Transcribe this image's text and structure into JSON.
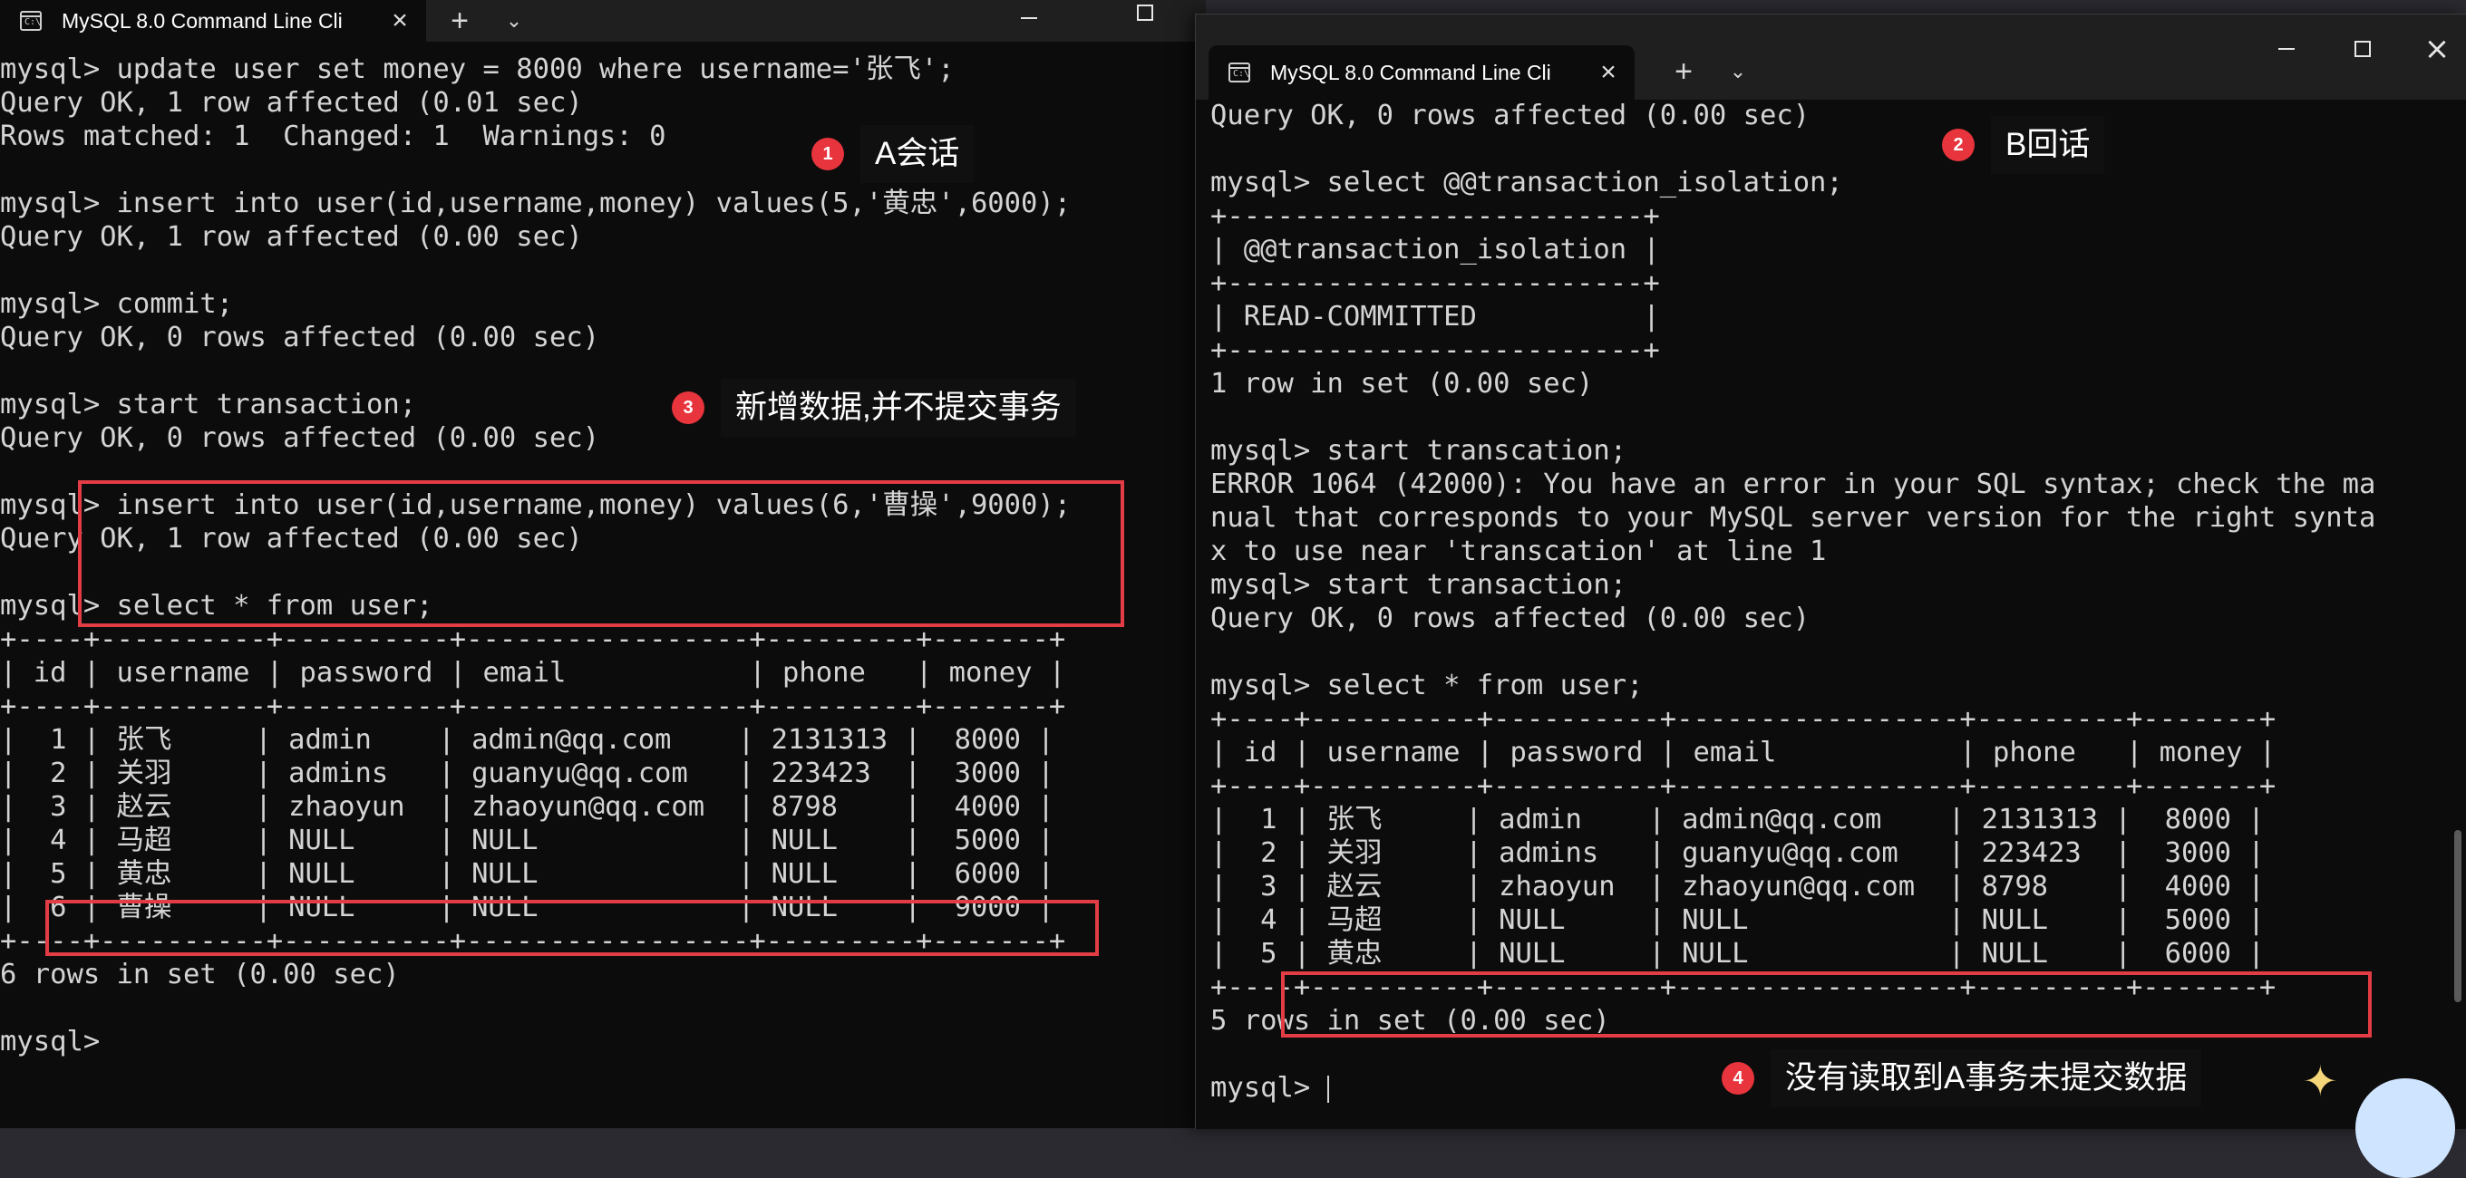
{
  "windowA": {
    "tab_title": "MySQL 8.0 Command Line Cli",
    "tab_icon_text": "C:\\",
    "terminal_text": "mysql> update user set money = 8000 where username='张飞';\nQuery OK, 1 row affected (0.01 sec)\nRows matched: 1  Changed: 1  Warnings: 0\n\nmysql> insert into user(id,username,money) values(5,'黄忠',6000);\nQuery OK, 1 row affected (0.00 sec)\n\nmysql> commit;\nQuery OK, 0 rows affected (0.00 sec)\n\nmysql> start transaction;\nQuery OK, 0 rows affected (0.00 sec)\n\nmysql> insert into user(id,username,money) values(6,'曹操',9000);\nQuery OK, 1 row affected (0.00 sec)\n\nmysql> select * from user;\n+----+----------+----------+-----------------+---------+-------+\n| id | username | password | email           | phone   | money |\n+----+----------+----------+-----------------+---------+-------+\n|  1 | 张飞     | admin    | admin@qq.com    | 2131313 |  8000 |\n|  2 | 关羽     | admins   | guanyu@qq.com   | 223423  |  3000 |\n|  3 | 赵云     | zhaoyun  | zhaoyun@qq.com  | 8798    |  4000 |\n|  4 | 马超     | NULL     | NULL            | NULL    |  5000 |\n|  5 | 黄忠     | NULL     | NULL            | NULL    |  6000 |\n|  6 | 曹操     | NULL     | NULL            | NULL    |  9000 |\n+----+----------+----------+-----------------+---------+-------+\n6 rows in set (0.00 sec)\n\nmysql>"
  },
  "windowB": {
    "tab_title": "MySQL 8.0 Command Line Cli",
    "tab_icon_text": "C:\\",
    "terminal_text": "Query OK, 0 rows affected (0.00 sec)\n\nmysql> select @@transaction_isolation;\n+-------------------------+\n| @@transaction_isolation |\n+-------------------------+\n| READ-COMMITTED          |\n+-------------------------+\n1 row in set (0.00 sec)\n\nmysql> start transcation;\nERROR 1064 (42000): You have an error in your SQL syntax; check the ma\nnual that corresponds to your MySQL server version for the right synta\nx to use near 'transcation' at line 1\nmysql> start transaction;\nQuery OK, 0 rows affected (0.00 sec)\n\nmysql> select * from user;\n+----+----------+----------+-----------------+---------+-------+\n| id | username | password | email           | phone   | money |\n+----+----------+----------+-----------------+---------+-------+\n|  1 | 张飞     | admin    | admin@qq.com    | 2131313 |  8000 |\n|  2 | 关羽     | admins   | guanyu@qq.com   | 223423  |  3000 |\n|  3 | 赵云     | zhaoyun  | zhaoyun@qq.com  | 8798    |  4000 |\n|  4 | 马超     | NULL     | NULL            | NULL    |  5000 |\n|  5 | 黄忠     | NULL     | NULL            | NULL    |  6000 |\n+----+----------+----------+-----------------+---------+-------+\n5 rows in set (0.00 sec)\n\nmysql> "
  },
  "annotations": [
    {
      "number": "1",
      "text": "A会话"
    },
    {
      "number": "2",
      "text": "B回话"
    },
    {
      "number": "3",
      "text": "新增数据,并不提交事务"
    },
    {
      "number": "4",
      "text": "没有读取到A事务未提交数据"
    }
  ],
  "icons": {
    "new_tab": "+",
    "dropdown": "⌄",
    "close": "×",
    "sparkle": "✦"
  },
  "colors": {
    "terminal_bg": "#0c0c0c",
    "terminal_text": "#d4d4d4",
    "highlight_box": "#e23c44",
    "badge": "#e8343c"
  }
}
